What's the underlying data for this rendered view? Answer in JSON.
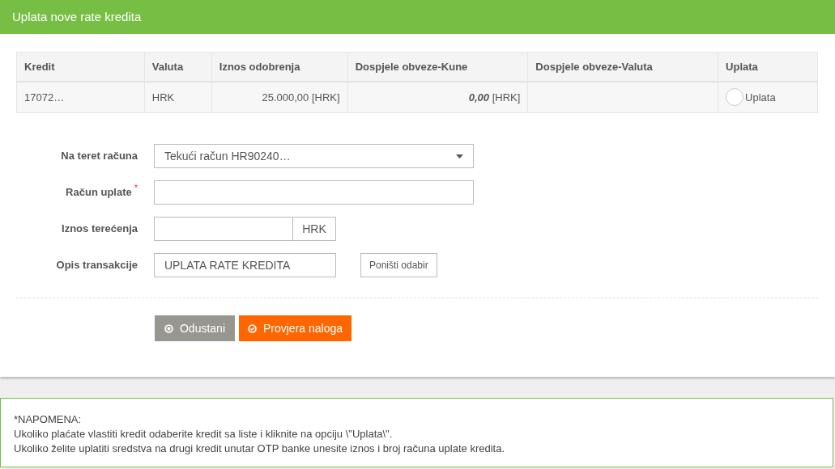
{
  "header": {
    "title": "Uplata nove rate kredita"
  },
  "table": {
    "columns": [
      "Kredit",
      "Valuta",
      "Iznos odobrenja",
      "Dospjele obveze-Kune",
      "Dospjele obveze-Valuta",
      "Uplata"
    ],
    "rows": [
      {
        "kredit": "17072…",
        "valuta": "HRK",
        "iznos": "25.000,00 [HRK]",
        "kune_amount": "0,00",
        "kune_unit": "[HRK]",
        "uplata": {
          "label": "Uplata",
          "selected": false
        }
      }
    ]
  },
  "form": [
    {
      "kind": "select",
      "label": "Na teret računa",
      "value": "Tekući račun HR90240…"
    },
    {
      "kind": "input",
      "label": "Račun uplate",
      "required_mark": "*"
    },
    {
      "kind": "addon",
      "label": "Iznos terećenja",
      "addon": "HRK"
    },
    {
      "kind": "button",
      "label": "Opis transakcije",
      "value": "UPLATA RATE KREDITA",
      "button": "Poništi odabir"
    }
  ],
  "actions": [
    {
      "kind": "cancel",
      "label": "Odustani"
    },
    {
      "kind": "confirm",
      "label": "Provjera naloga"
    }
  ],
  "note": [
    "*NAPOMENA:",
    "Ukoliko plaćate vlastiti kredit odaberite kredit sa liste i kliknite na opciju \\\"Uplata\\\".",
    "Ukoliko želite uplatiti sredstva na drugi kredit unutar OTP banke unesite iznos i broj računa uplate kredita."
  ]
}
